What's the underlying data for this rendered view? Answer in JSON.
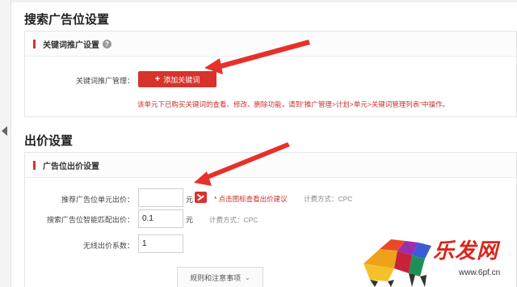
{
  "search_section": {
    "title": "搜索广告位设置",
    "panel_title": "关键词推广设置",
    "help_icon_glyph": "?",
    "keyword_label": "关键词推广管理：",
    "add_button_icon": "+",
    "add_button_label": "添加关键词",
    "notice": "该单元下已购买关键词的查看、修改、删除功能，请到“推广管理>计划>单元>关键词管理列表”中操作。"
  },
  "bid_section": {
    "title": "出价设置",
    "panel_title": "广告位出价设置",
    "rows": [
      {
        "label": "推荐广告位单元出价：",
        "value": "",
        "unit": "元",
        "hint": "* 点击图标查看出价建议",
        "billing": "计费方式：CPC"
      },
      {
        "label": "搜索广告位智能匹配出价：",
        "value": "0.1",
        "unit": "元",
        "billing": "计费方式：CPC"
      },
      {
        "label": "无线出价系数：",
        "value": "1"
      }
    ],
    "rules_toggle": "规则和注意事项",
    "rules_chevron": "⌄"
  },
  "watermark": {
    "brand": "乐发网",
    "site": "www.6pf.cn"
  },
  "colors": {
    "accent_red": "#d8322b",
    "notice_red": "#c8302a",
    "annotation_arrow": "#e8302a"
  },
  "icons": [
    "help-icon",
    "plus-icon",
    "bid-suggestion-icon",
    "chevron-down-icon",
    "annotation-arrow"
  ]
}
